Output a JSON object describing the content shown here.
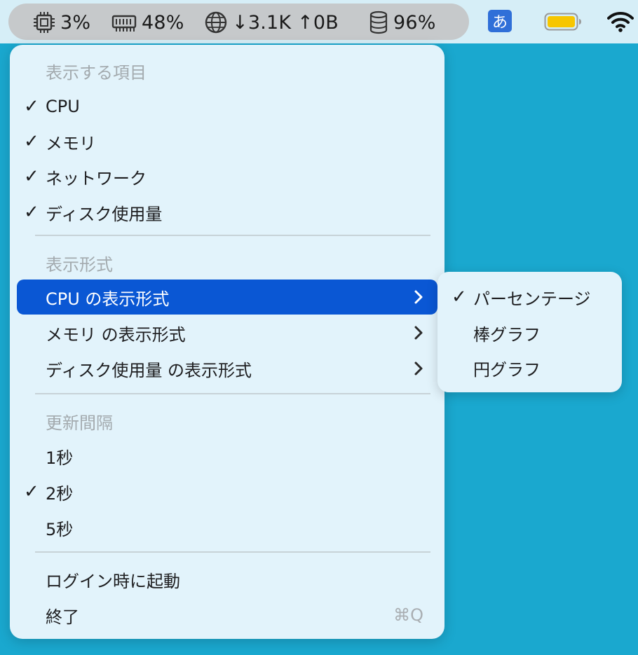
{
  "menubar": {
    "cpu": "3%",
    "memory": "48%",
    "network": "↓3.1K ↑0B",
    "disk": "96%",
    "ime": "あ",
    "icons": [
      "cpu-chip-icon",
      "memory-module-icon",
      "globe-icon",
      "database-icon",
      "battery-icon",
      "wifi-icon"
    ]
  },
  "menu": {
    "section_items": "表示する項目",
    "item_cpu": "CPU",
    "item_memory": "メモリ",
    "item_network": "ネットワーク",
    "item_disk": "ディスク使用量",
    "section_format": "表示形式",
    "format_cpu": "CPU の表示形式",
    "format_memory": "メモリ の表示形式",
    "format_disk": "ディスク使用量 の表示形式",
    "section_interval": "更新間隔",
    "interval_1": "1秒",
    "interval_2": "2秒",
    "interval_5": "5秒",
    "launch_login": "ログイン時に起動",
    "quit": "終了",
    "quit_shortcut": "⌘Q",
    "checkmark": "✓"
  },
  "submenu": {
    "percentage": "パーセンテージ",
    "bar_graph": "棒グラフ",
    "pie_graph": "円グラフ",
    "checkmark": "✓"
  },
  "colors": {
    "highlight": "#0a57d4",
    "desktop": "#1aa8cf",
    "menu_bg": "#e2f3fb",
    "battery": "#f7c600"
  }
}
